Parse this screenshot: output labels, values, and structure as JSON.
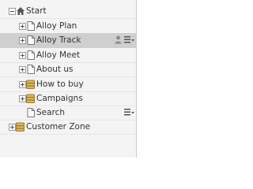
{
  "tree": {
    "root_label": "Start",
    "items": [
      {
        "label": "Alloy Plan"
      },
      {
        "label": "Alloy Track"
      },
      {
        "label": "Alloy Meet"
      },
      {
        "label": "About us"
      },
      {
        "label": "How to buy"
      },
      {
        "label": "Campaigns"
      },
      {
        "label": "Search"
      }
    ],
    "sibling_label": "Customer Zone"
  },
  "colors": {
    "panel_background": "#f4f4f4",
    "selected_row": "#cfcfcf",
    "folder_icon": "#c9a34e"
  },
  "icons": [
    "collapse-icon",
    "home-icon",
    "expand-icon",
    "page-icon",
    "folder-icon",
    "user-icon",
    "context-menu-icon"
  ]
}
